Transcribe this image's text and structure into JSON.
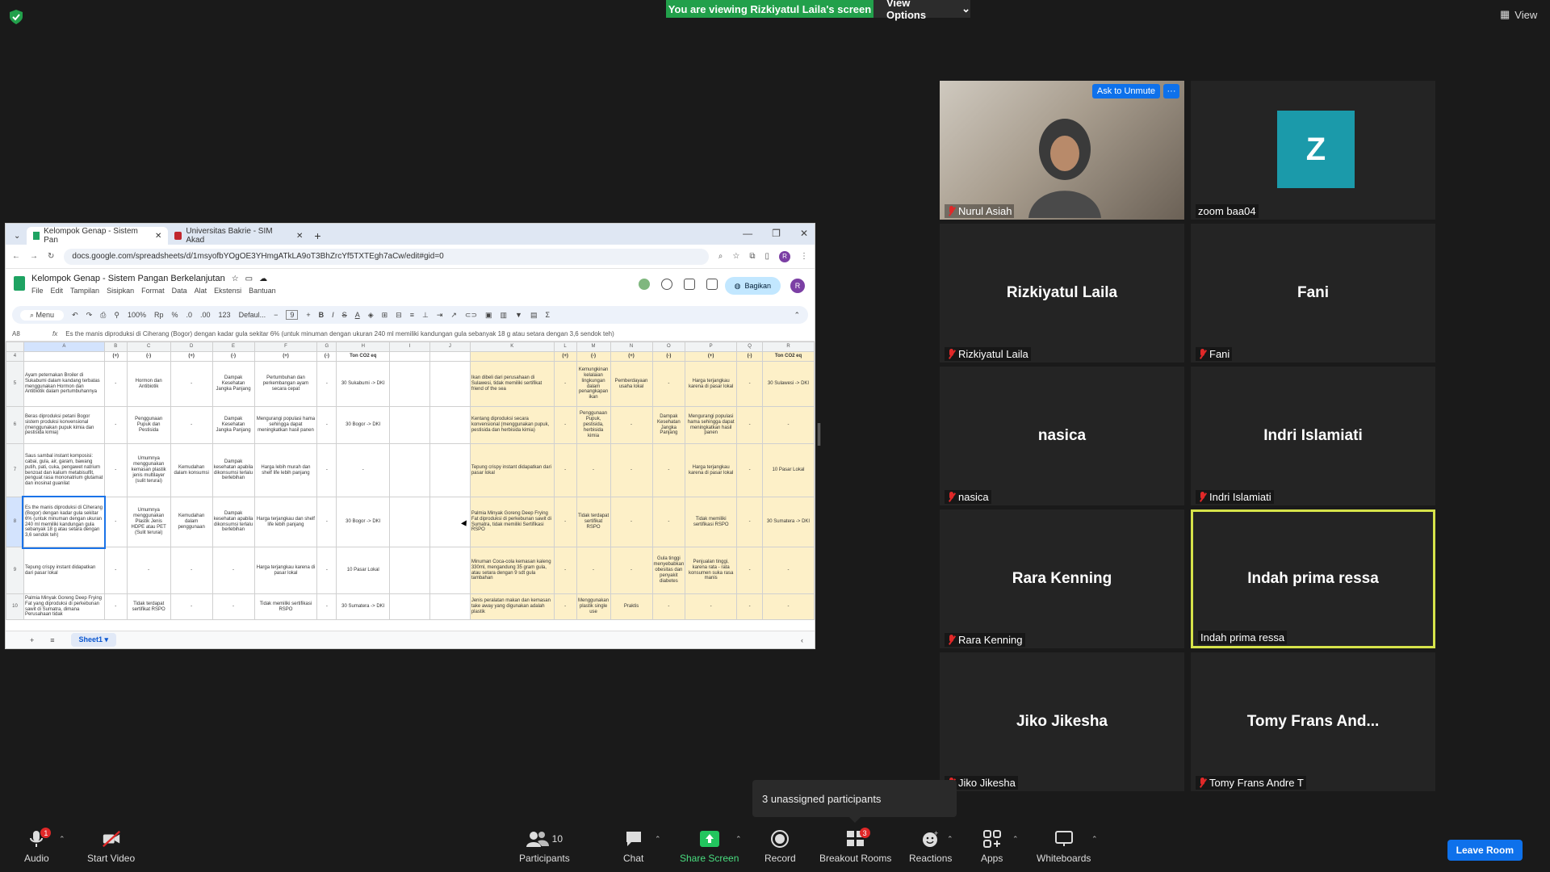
{
  "meeting": {
    "viewing_banner": "You are viewing Rizkiyatul Laila's screen",
    "view_options": "View Options",
    "view": "View"
  },
  "browser": {
    "tabs": [
      {
        "title": "Kelompok Genap - Sistem Pan"
      },
      {
        "title": "Universitas Bakrie - SIM Akad"
      }
    ],
    "url": "docs.google.com/spreadsheets/d/1msyofbYOgOE3YHmgATkLA9oT3BhZrcYf5TXTEgh7aCw/edit#gid=0",
    "doc_title": "Kelompok Genap - Sistem Pangan Berkelanjutan",
    "menu": [
      "File",
      "Edit",
      "Tampilan",
      "Sisipkan",
      "Format",
      "Data",
      "Alat",
      "Ekstensi",
      "Bantuan"
    ],
    "share_label": "Bagikan",
    "avatar_letter": "R",
    "toolbar": {
      "menu": "Menu",
      "zoom": "100%",
      "currency": "Rp",
      "percent": "%",
      "dec_less": ".0",
      "dec_more": ".00",
      "num": "123",
      "font": "Defaul...",
      "font_size": "9"
    },
    "cell_ref": "A8",
    "formula": "Es the manis diproduksi di Ciherang (Bogor) dengan kadar gula sekitar 6% (untuk minuman dengan ukuran 240 ml memiliki kandungan gula sebanyak 18 g atau setara dengan 3,6 sendok teh)",
    "columns": [
      "A",
      "B",
      "C",
      "D",
      "E",
      "F",
      "G",
      "H",
      "I",
      "J",
      "K",
      "L",
      "M",
      "N",
      "O",
      "P",
      "Q",
      "R"
    ],
    "header_row": {
      "num": "4",
      "cells": [
        "",
        "(+)",
        "(-)",
        "(+)",
        "(-)",
        "(+)",
        "(-)",
        "Ton CO2 eq",
        "",
        "",
        "",
        "(+)",
        "(-)",
        "(+)",
        "(-)",
        "(+)",
        "(-)",
        "Ton CO2 eq"
      ]
    },
    "rows": [
      {
        "num": "5",
        "cells": [
          "Ayam peternakan Broiler di Sukabumi dalam kandang terbatas menggunakan Hormon dan Antibiotik dalam pertumbuhannya",
          "-",
          "Hormon dan Antibiotik",
          "-",
          "Dampak Kesehatan Jangka Panjang",
          "Pertumbuhan dan perkembangan ayam secara cepat",
          "-",
          "30 Sukabumi -> DKI",
          "",
          "",
          "Ikan dibeli dari perusahaan di Sulawesi, tidak memiliki sertifikat friend of the sea",
          "-",
          "Kemungkinan kelalaian lingkungan dalam penangkapan ikan",
          "Pemberdayaan usaha lokal",
          "-",
          "Harga terjangkau karena di pasar lokal",
          "-",
          "30 Sulawesi -> DKI"
        ]
      },
      {
        "num": "6",
        "cells": [
          "Beras diproduksi petani Bogor sistem produksi konvensional (menggunakan pupuk kimia dan pestisida kimia)",
          "-",
          "Penggunaan Pupuk dan Pestisida",
          "-",
          "Dampak Kesehatan Jangka Panjang",
          "Mengurangi populasi hama sehingga dapat meningkatkan hasil panen",
          "-",
          "30 Bogor -> DKI",
          "",
          "",
          "Kentang diproduksi secara konvensional (menggunakan pupuk, pestisida dan herbisida kimia)",
          "-",
          "Penggunaan Pupuk, pestisida, herbisida kimia",
          "-",
          "Dampak Kesehatan Jangka Panjang",
          "Mengurangi populasi hama sehingga dapat meningkatkan hasil panen",
          "-",
          "-"
        ]
      },
      {
        "num": "7",
        "cells": [
          "Saus sambal instant komposisi: cabai, gula, air, garam, bawang putih, pati, cuka, pengawet natrium benzoat dan kalium metabisulfit, penguat rasa mononatrium glutamat dan inosinat guanilat",
          "-",
          "Umumnya menggunakan kemasan plastik jenis multilayer (sulit terurai)",
          "Kemudahan dalam konsumsi",
          "Dampak kesehatan apabila dikonsumsi terlalu berlebihan",
          "Harga lebih murah dan shelf life lebih panjang",
          "-",
          "-",
          "",
          "",
          "Tepung crispy instant didapatkan dari pasar lokal",
          "-",
          "-",
          "-",
          "-",
          "Harga terjangkau karena di pasar lokal",
          "-",
          "10 Pasar Lokal"
        ]
      },
      {
        "num": "8",
        "cells": [
          "Es the manis diproduksi di Ciherang (Bogor) dengan kadar gula sekitar 6% (untuk minuman dengan ukuran 240 ml memiliki kandungan gula sebanyak 18 g atau setara dengan 3,6 sendok teh)",
          "-",
          "Umumnya menggunakan Plastik Jenis HDPE atau PET (Sulit terurai)",
          "Kemudahan dalam penggunaan",
          "Dampak kesehatan apabila dikonsumsi terlalu berlebihan",
          "Harga terjangkau dan shelf life lebih panjang",
          "-",
          "30 Bogor -> DKI",
          "",
          "",
          "Palmia Minyak Goreng Deep Frying Fat diproduksi di perkebunan sawit di Sumatra, tidak memiliki Sertifikasi RSPO",
          "-",
          "Tidak terdapat sertifikat RSPO",
          "-",
          "-",
          "Tidak memiliki sertifikasi RSPO",
          "-",
          "30 Sumatera -> DKI"
        ]
      },
      {
        "num": "9",
        "cells": [
          "Tepung crispy instant didapatkan dari pasar lokal",
          "-",
          "-",
          "-",
          "-",
          "Harga terjangkau karena di pasar lokal",
          "-",
          "10 Pasar Lokal",
          "",
          "",
          "Minuman Coca-cola kemasan kaleng 330ml, mengandung 35 gram gula, atau setara dengan 9 sdt gula tambahan",
          "-",
          "-",
          "-",
          "Gula tinggi menyebabkan obesitas dan penyakit diabetes",
          "Penjualan tinggi, karena rata - rata konsumen suka rasa manis",
          "-",
          "-"
        ]
      },
      {
        "num": "10",
        "cells": [
          "Palmia Minyak Goreng Deep Frying Fat yang diproduksi di perkebunan sawit di Sumatra, dimana Perusahaan tidak",
          "-",
          "Tidak terdapat sertifikat RSPO",
          "-",
          "-",
          "Tidak memiliki sertifikasi RSPO",
          "-",
          "30 Sumatera -> DKI",
          "",
          "",
          "Jenis peralatan makan dan kemasan take away yang digunakan adalah plastik",
          "-",
          "Menggunakan plastik single use",
          "Praktis",
          "-",
          "-",
          "-",
          "-"
        ]
      }
    ],
    "sheet_tab": "Sheet1"
  },
  "participants": [
    {
      "name": "Nurul Asiah",
      "video": true,
      "muted": true
    },
    {
      "name": "zoom baa04",
      "avatar": "Z",
      "muted": false
    },
    {
      "name": "Rizkiyatul Laila",
      "muted": true
    },
    {
      "name": "Fani",
      "muted": true
    },
    {
      "name": "nasica",
      "muted": true
    },
    {
      "name": "Indri Islamiati",
      "muted": true
    },
    {
      "name": "Rara Kenning",
      "muted": true
    },
    {
      "name": "Indah prima ressa",
      "muted": false,
      "active": true
    },
    {
      "name": "Jiko Jikesha",
      "muted": true
    },
    {
      "name": "Tomy  Frans  And...",
      "label": "Tomy Frans Andre T",
      "muted": true
    }
  ],
  "ask_to_unmute": "Ask to Unmute",
  "tile_more": "···",
  "unassigned_tooltip": "3 unassigned participants",
  "bottom_toolbar": {
    "audio": "Audio",
    "audio_badge": "1",
    "start_video": "Start Video",
    "participants": "Participants",
    "participants_count": "10",
    "chat": "Chat",
    "share_screen": "Share Screen",
    "record": "Record",
    "breakout_rooms": "Breakout Rooms",
    "breakout_badge": "3",
    "reactions": "Reactions",
    "apps": "Apps",
    "whiteboards": "Whiteboards",
    "leave_room": "Leave Room"
  },
  "colors": {
    "banner": "#22a04b",
    "accent": "#0e71eb",
    "active_border": "#d6e34a",
    "muted": "#e02828",
    "sheet_highlight": "#fdf0c8"
  }
}
